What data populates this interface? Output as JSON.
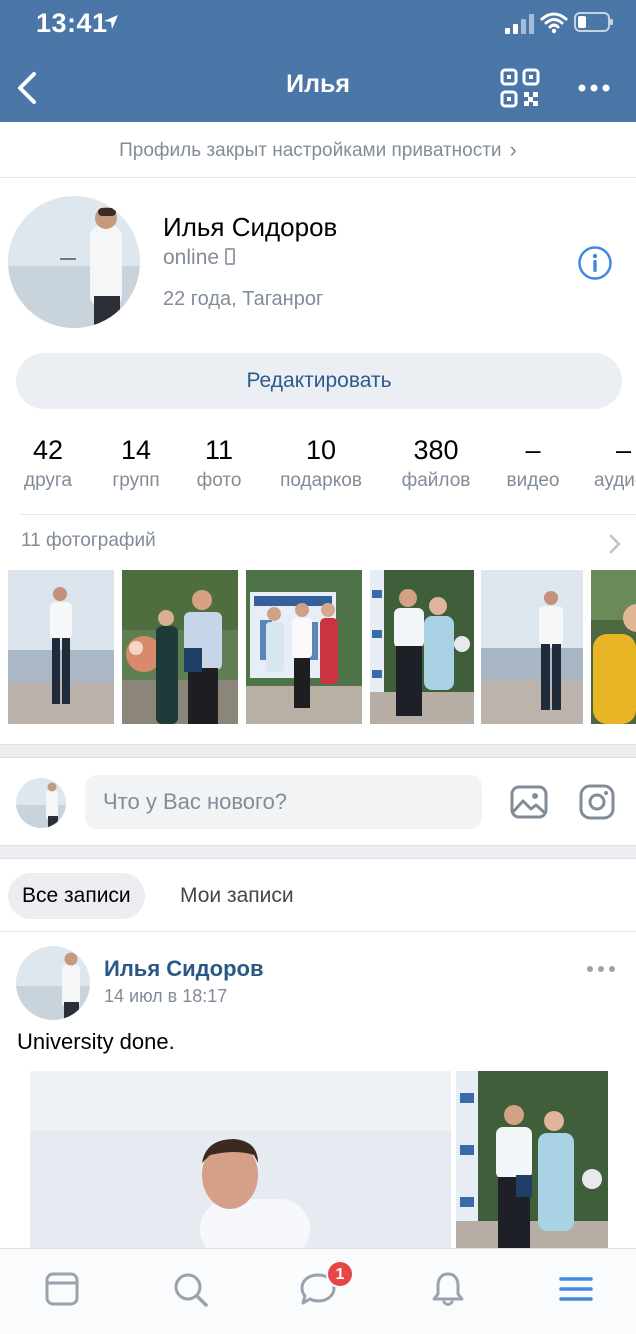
{
  "status_bar": {
    "time": "13:41"
  },
  "nav": {
    "title": "Илья",
    "back_icon": "chevron-left-icon",
    "qr_icon": "qr-code-icon",
    "more_icon": "more-horizontal-icon"
  },
  "privacy_notice": "Профиль закрыт настройками приватности",
  "profile": {
    "name": "Илья Сидоров",
    "status": "online",
    "age_city": "22 года, Таганрог",
    "edit_label": "Редактировать"
  },
  "counters": [
    {
      "value": "42",
      "label": "друга"
    },
    {
      "value": "14",
      "label": "групп"
    },
    {
      "value": "11",
      "label": "фото"
    },
    {
      "value": "10",
      "label": "подарков"
    },
    {
      "value": "380",
      "label": "файлов"
    },
    {
      "value": "–",
      "label": "видео"
    },
    {
      "value": "–",
      "label": "аудио"
    }
  ],
  "photos": {
    "header": "11 фотографий"
  },
  "composer": {
    "placeholder": "Что у Вас нового?"
  },
  "wall_tabs": {
    "all": "Все записи",
    "mine": "Мои записи"
  },
  "post": {
    "author": "Илья Сидоров",
    "date": "14 июл в 18:17",
    "text": "University done."
  },
  "tabbar": {
    "items": [
      "news-feed-icon",
      "search-icon",
      "messages-icon",
      "notifications-icon",
      "menu-icon"
    ],
    "messages_badge": "1"
  },
  "colors": {
    "header": "#4a76a8",
    "accent": "#2a5885",
    "badge": "#e64646"
  }
}
